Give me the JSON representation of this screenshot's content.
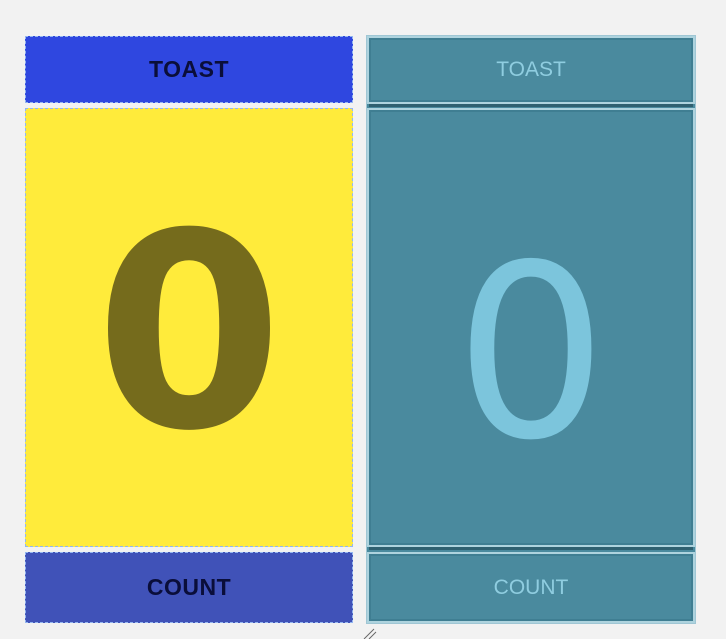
{
  "design_view": {
    "toast_button": {
      "label": "TOAST",
      "color": "#2f47e0"
    },
    "count_display": {
      "value": "0",
      "background": "#ffeb3b"
    },
    "count_button": {
      "label": "COUNT",
      "color": "#4052b8"
    }
  },
  "blueprint_view": {
    "toast_button": {
      "label": "TOAST"
    },
    "count_display": {
      "value": "0"
    },
    "count_button": {
      "label": "COUNT"
    },
    "color": "#4a8a9e"
  },
  "icons": {
    "resize_handle": "resize-handle-icon"
  }
}
